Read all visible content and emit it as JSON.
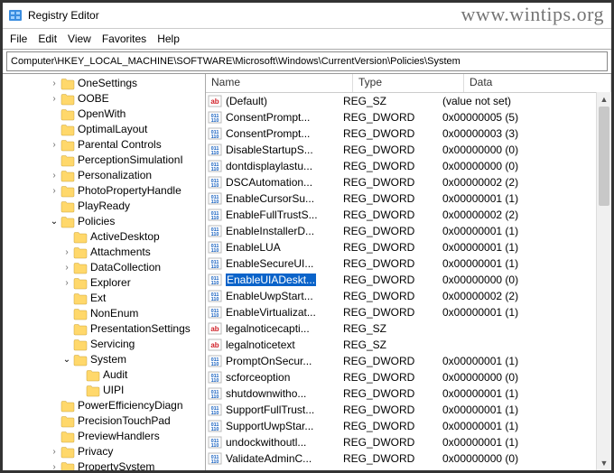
{
  "window": {
    "title": "Registry Editor"
  },
  "watermark": "www.wintips.org",
  "menu": [
    "File",
    "Edit",
    "View",
    "Favorites",
    "Help"
  ],
  "address": "Computer\\HKEY_LOCAL_MACHINE\\SOFTWARE\\Microsoft\\Windows\\CurrentVersion\\Policies\\System",
  "tree": [
    {
      "depth": 3,
      "expand": "closed",
      "label": "OneSettings"
    },
    {
      "depth": 3,
      "expand": "closed",
      "label": "OOBE"
    },
    {
      "depth": 3,
      "expand": "none",
      "label": "OpenWith"
    },
    {
      "depth": 3,
      "expand": "none",
      "label": "OptimalLayout"
    },
    {
      "depth": 3,
      "expand": "closed",
      "label": "Parental Controls"
    },
    {
      "depth": 3,
      "expand": "none",
      "label": "PerceptionSimulationI"
    },
    {
      "depth": 3,
      "expand": "closed",
      "label": "Personalization"
    },
    {
      "depth": 3,
      "expand": "closed",
      "label": "PhotoPropertyHandle"
    },
    {
      "depth": 3,
      "expand": "none",
      "label": "PlayReady"
    },
    {
      "depth": 3,
      "expand": "open",
      "label": "Policies"
    },
    {
      "depth": 4,
      "expand": "none",
      "label": "ActiveDesktop"
    },
    {
      "depth": 4,
      "expand": "closed",
      "label": "Attachments"
    },
    {
      "depth": 4,
      "expand": "closed",
      "label": "DataCollection"
    },
    {
      "depth": 4,
      "expand": "closed",
      "label": "Explorer"
    },
    {
      "depth": 4,
      "expand": "none",
      "label": "Ext"
    },
    {
      "depth": 4,
      "expand": "none",
      "label": "NonEnum"
    },
    {
      "depth": 4,
      "expand": "none",
      "label": "PresentationSettings"
    },
    {
      "depth": 4,
      "expand": "none",
      "label": "Servicing"
    },
    {
      "depth": 4,
      "expand": "open",
      "label": "System"
    },
    {
      "depth": 5,
      "expand": "none",
      "label": "Audit"
    },
    {
      "depth": 5,
      "expand": "none",
      "label": "UIPI"
    },
    {
      "depth": 3,
      "expand": "none",
      "label": "PowerEfficiencyDiagn"
    },
    {
      "depth": 3,
      "expand": "none",
      "label": "PrecisionTouchPad"
    },
    {
      "depth": 3,
      "expand": "none",
      "label": "PreviewHandlers"
    },
    {
      "depth": 3,
      "expand": "closed",
      "label": "Privacy"
    },
    {
      "depth": 3,
      "expand": "closed",
      "label": "PropertySystem"
    }
  ],
  "columns": {
    "name": "Name",
    "type": "Type",
    "data": "Data"
  },
  "values": [
    {
      "icon": "sz",
      "name": "(Default)",
      "type": "REG_SZ",
      "data": "(value not set)",
      "selected": false
    },
    {
      "icon": "dword",
      "name": "ConsentPrompt...",
      "type": "REG_DWORD",
      "data": "0x00000005 (5)",
      "selected": false
    },
    {
      "icon": "dword",
      "name": "ConsentPrompt...",
      "type": "REG_DWORD",
      "data": "0x00000003 (3)",
      "selected": false
    },
    {
      "icon": "dword",
      "name": "DisableStartupS...",
      "type": "REG_DWORD",
      "data": "0x00000000 (0)",
      "selected": false
    },
    {
      "icon": "dword",
      "name": "dontdisplaylastu...",
      "type": "REG_DWORD",
      "data": "0x00000000 (0)",
      "selected": false
    },
    {
      "icon": "dword",
      "name": "DSCAutomation...",
      "type": "REG_DWORD",
      "data": "0x00000002 (2)",
      "selected": false
    },
    {
      "icon": "dword",
      "name": "EnableCursorSu...",
      "type": "REG_DWORD",
      "data": "0x00000001 (1)",
      "selected": false
    },
    {
      "icon": "dword",
      "name": "EnableFullTrustS...",
      "type": "REG_DWORD",
      "data": "0x00000002 (2)",
      "selected": false
    },
    {
      "icon": "dword",
      "name": "EnableInstallerD...",
      "type": "REG_DWORD",
      "data": "0x00000001 (1)",
      "selected": false
    },
    {
      "icon": "dword",
      "name": "EnableLUA",
      "type": "REG_DWORD",
      "data": "0x00000001 (1)",
      "selected": false
    },
    {
      "icon": "dword",
      "name": "EnableSecureUI...",
      "type": "REG_DWORD",
      "data": "0x00000001 (1)",
      "selected": false
    },
    {
      "icon": "dword",
      "name": "EnableUIADeskt...",
      "type": "REG_DWORD",
      "data": "0x00000000 (0)",
      "selected": true
    },
    {
      "icon": "dword",
      "name": "EnableUwpStart...",
      "type": "REG_DWORD",
      "data": "0x00000002 (2)",
      "selected": false
    },
    {
      "icon": "dword",
      "name": "EnableVirtualizat...",
      "type": "REG_DWORD",
      "data": "0x00000001 (1)",
      "selected": false
    },
    {
      "icon": "sz",
      "name": "legalnoticecapti...",
      "type": "REG_SZ",
      "data": "",
      "selected": false
    },
    {
      "icon": "sz",
      "name": "legalnoticetext",
      "type": "REG_SZ",
      "data": "",
      "selected": false
    },
    {
      "icon": "dword",
      "name": "PromptOnSecur...",
      "type": "REG_DWORD",
      "data": "0x00000001 (1)",
      "selected": false
    },
    {
      "icon": "dword",
      "name": "scforceoption",
      "type": "REG_DWORD",
      "data": "0x00000000 (0)",
      "selected": false
    },
    {
      "icon": "dword",
      "name": "shutdownwitho...",
      "type": "REG_DWORD",
      "data": "0x00000001 (1)",
      "selected": false
    },
    {
      "icon": "dword",
      "name": "SupportFullTrust...",
      "type": "REG_DWORD",
      "data": "0x00000001 (1)",
      "selected": false
    },
    {
      "icon": "dword",
      "name": "SupportUwpStar...",
      "type": "REG_DWORD",
      "data": "0x00000001 (1)",
      "selected": false
    },
    {
      "icon": "dword",
      "name": "undockwithoutl...",
      "type": "REG_DWORD",
      "data": "0x00000001 (1)",
      "selected": false
    },
    {
      "icon": "dword",
      "name": "ValidateAdminC...",
      "type": "REG_DWORD",
      "data": "0x00000000 (0)",
      "selected": false
    }
  ]
}
